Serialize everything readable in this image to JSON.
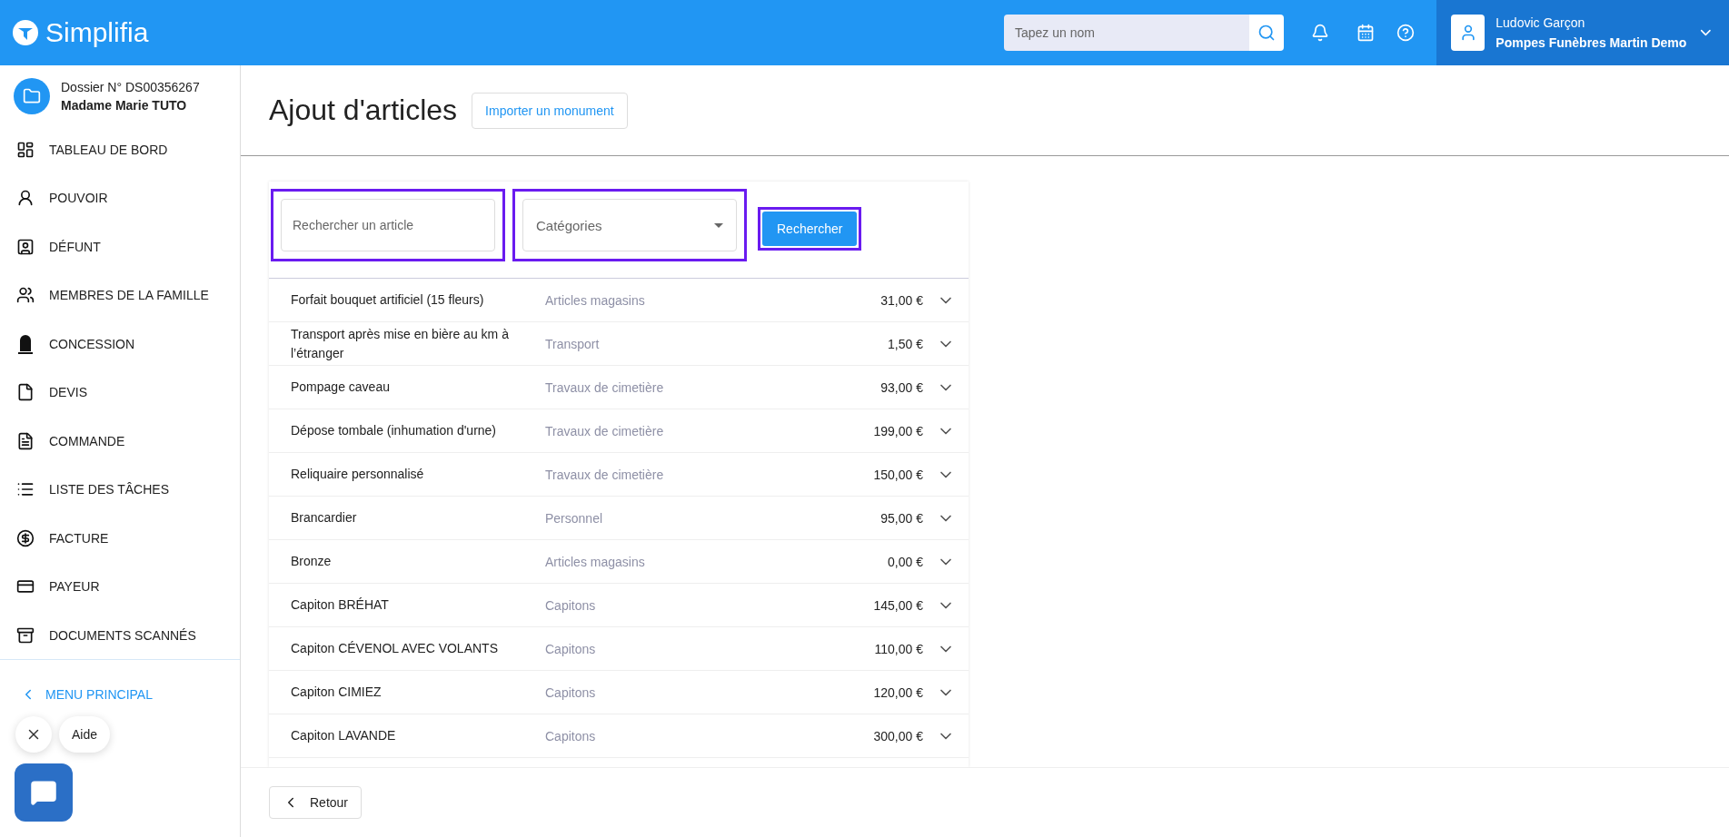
{
  "header": {
    "logo": "Simplifia",
    "search": {
      "placeholder": "Tapez un nom"
    },
    "user": {
      "name": "Ludovic Garçon",
      "company": "Pompes Funèbres Martin Demo"
    }
  },
  "sidebar": {
    "dossier": {
      "number": "Dossier N° DS00356267",
      "client": "Madame Marie TUTO"
    },
    "items": [
      {
        "kind": "dashboard",
        "label": "TABLEAU DE BORD"
      },
      {
        "kind": "person",
        "label": "POUVOIR"
      },
      {
        "kind": "contact",
        "label": "DÉFUNT"
      },
      {
        "kind": "group",
        "label": "MEMBRES DE LA FAMILLE"
      },
      {
        "kind": "grave",
        "label": "CONCESSION"
      },
      {
        "kind": "file",
        "label": "DEVIS"
      },
      {
        "kind": "document",
        "label": "COMMANDE"
      },
      {
        "kind": "list",
        "label": "LISTE DES TÂCHES"
      },
      {
        "kind": "dollar",
        "label": "FACTURE"
      },
      {
        "kind": "card",
        "label": "PAYEUR"
      },
      {
        "kind": "archive",
        "label": "DOCUMENTS SCANNÉS"
      }
    ],
    "back_link": "MENU PRINCIPAL"
  },
  "page": {
    "title": "Ajout d'articles",
    "import_button": "Importer un monument"
  },
  "filters": {
    "search": {
      "placeholder": "Rechercher un article"
    },
    "category": {
      "placeholder": "Catégories"
    },
    "button": "Rechercher"
  },
  "articles": [
    {
      "name": "Forfait bouquet artificiel (15 fleurs)",
      "category": "Articles magasins",
      "price": "31,00 €"
    },
    {
      "name": "Transport après mise en bière au km à l’étranger",
      "category": "Transport",
      "price": "1,50 €"
    },
    {
      "name": "Pompage caveau",
      "category": "Travaux de cimetière",
      "price": "93,00 €"
    },
    {
      "name": "Dépose tombale (inhumation d'urne)",
      "category": "Travaux de cimetière",
      "price": "199,00 €"
    },
    {
      "name": "Reliquaire personnalisé",
      "category": "Travaux de cimetière",
      "price": "150,00 €"
    },
    {
      "name": "Brancardier",
      "category": "Personnel",
      "price": "95,00 €"
    },
    {
      "name": "Bronze",
      "category": "Articles magasins",
      "price": "0,00 €"
    },
    {
      "name": "Capiton BRÉHAT",
      "category": "Capitons",
      "price": "145,00 €"
    },
    {
      "name": "Capiton CÉVENOL AVEC VOLANTS",
      "category": "Capitons",
      "price": "110,00 €"
    },
    {
      "name": "Capiton CIMIEZ",
      "category": "Capitons",
      "price": "120,00 €"
    },
    {
      "name": "Capiton LAVANDE",
      "category": "Capitons",
      "price": "300,00 €"
    }
  ],
  "footer": {
    "back_button": "Retour"
  },
  "chat": {
    "label": "Aide"
  }
}
